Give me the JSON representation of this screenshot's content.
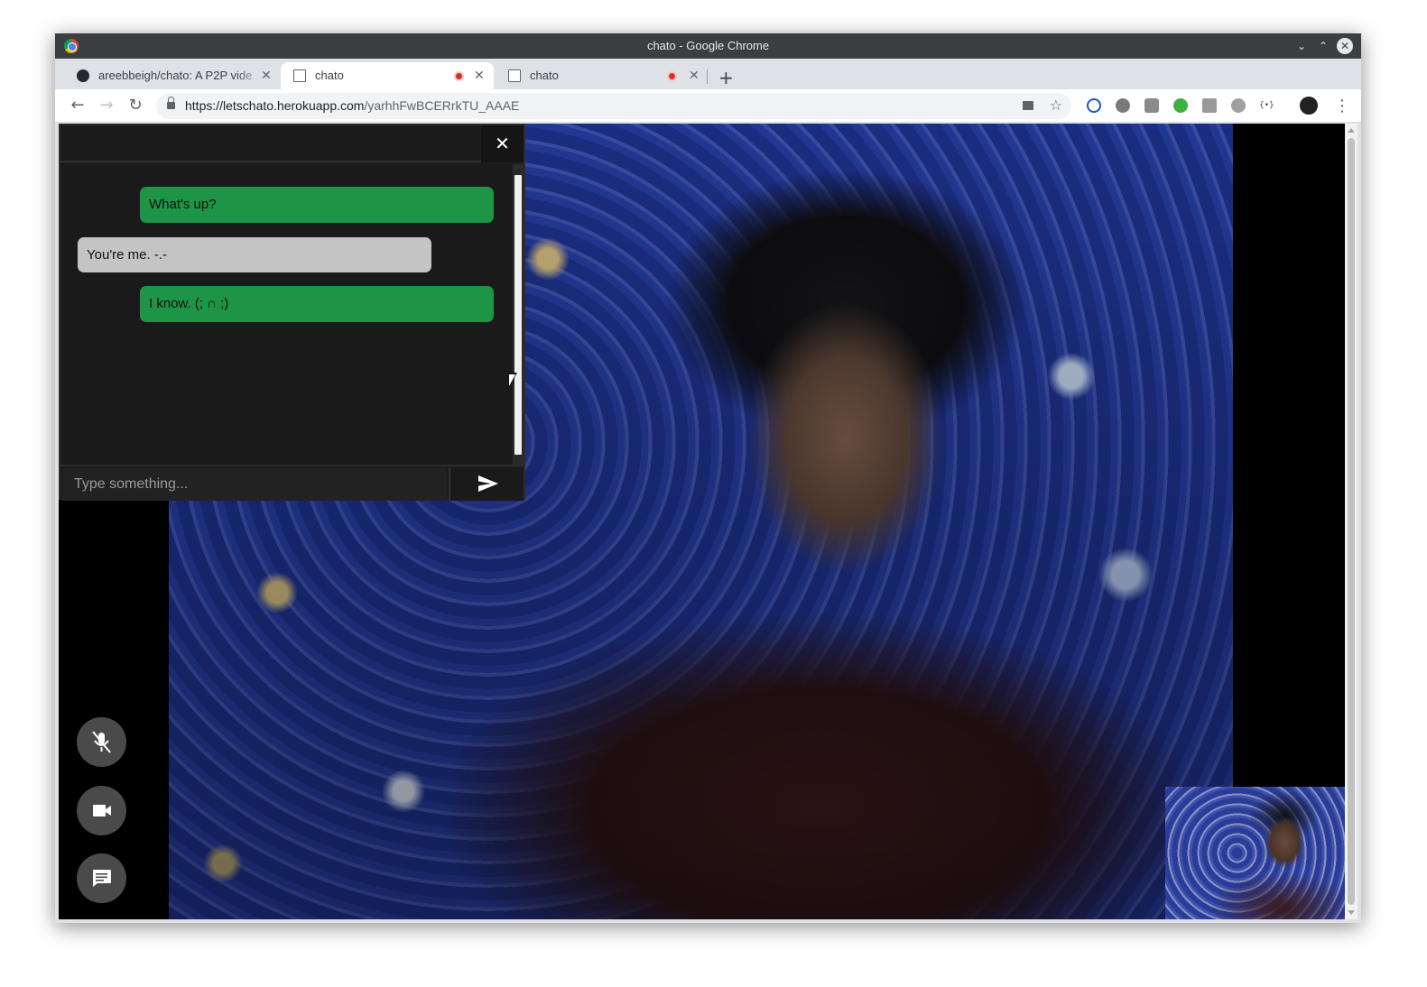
{
  "window": {
    "title": "chato - Google Chrome"
  },
  "tabs": [
    {
      "label": "areebbeigh/chato: A P2P vide",
      "favicon": "github-icon",
      "recording": false,
      "active": false
    },
    {
      "label": "chato",
      "favicon": "page-icon",
      "recording": true,
      "active": true
    },
    {
      "label": "chato",
      "favicon": "page-icon",
      "recording": true,
      "active": false
    }
  ],
  "newtab_label": "+",
  "toolbar": {
    "url_host": "https://letschato.herokuapp.com",
    "url_path": "/yarhhFwBCERrkTU_AAAE"
  },
  "chat": {
    "close_label": "✕",
    "messages": [
      {
        "text": "What's up?",
        "direction": "sent"
      },
      {
        "text": "You're me. -.-",
        "direction": "received"
      },
      {
        "text": "I know. (; ∩ ;)",
        "direction": "sent"
      }
    ],
    "input_placeholder": "Type something..."
  },
  "controls": {
    "mic": "mic-off-icon",
    "camera": "video-camera-icon",
    "chat": "chat-icon"
  },
  "colors": {
    "sent_bubble": "#1e9447",
    "received_bubble": "#c4c4c4",
    "control_button": "#4a4a4a",
    "titlebar": "#3c3f41"
  }
}
